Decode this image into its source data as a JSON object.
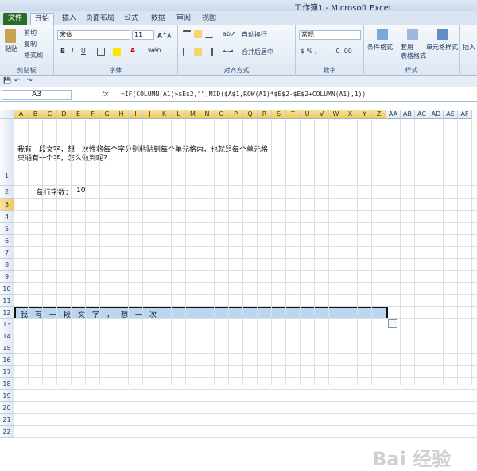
{
  "window": {
    "title": "工作簿1 - Microsoft Excel"
  },
  "tabs": [
    "文件",
    "开始",
    "插入",
    "页面布局",
    "公式",
    "数据",
    "审阅",
    "视图"
  ],
  "ribbon": {
    "clipboard": {
      "paste": "粘贴",
      "cut": "剪切",
      "copy": "复制",
      "format_painter": "格式刷",
      "label": "剪贴板"
    },
    "font": {
      "name": "宋体",
      "size": "11",
      "label": "字体"
    },
    "alignment": {
      "wrap": "自动换行",
      "merge": "合并后居中",
      "label": "对齐方式"
    },
    "number": {
      "format": "常规",
      "label": "数字"
    },
    "styles": {
      "cond": "条件格式",
      "table": "套用\n表格格式",
      "cell": "单元格样式",
      "label": "样式"
    },
    "insert": "插入"
  },
  "formula_bar": {
    "name_box": "A3",
    "fx": "fx",
    "formula": "=IF(COLUMN(A1)>$E$2,\"\",MID($A$1,ROW(A1)*$E$2-$E$2+COLUMN(A1),1))"
  },
  "columns": [
    "A",
    "B",
    "C",
    "D",
    "E",
    "F",
    "G",
    "H",
    "I",
    "J",
    "K",
    "L",
    "M",
    "N",
    "O",
    "P",
    "Q",
    "R",
    "S",
    "T",
    "U",
    "V",
    "W",
    "X",
    "Y",
    "Z",
    "AA",
    "AB",
    "AC",
    "AD",
    "AE",
    "AF"
  ],
  "rows": [
    "1",
    "2",
    "3",
    "4",
    "5",
    "6",
    "7",
    "8",
    "9",
    "10",
    "11",
    "12",
    "13",
    "14",
    "15",
    "16",
    "17",
    "18",
    "19",
    "20",
    "21",
    "22"
  ],
  "cells": {
    "a1_line1": "我有一段文字，想一次性将每个字分别粘贴到每个单元格内，也就是每个单元格",
    "a1_line2": "只通有一个字，怎么做到呢？",
    "b2_label": "每行字数：",
    "e2_value": "10",
    "row3_chars": [
      "我",
      "有",
      "一",
      "段",
      "文",
      "字",
      "，",
      "想",
      "一",
      "次"
    ]
  },
  "watermark": "Bai 经验"
}
